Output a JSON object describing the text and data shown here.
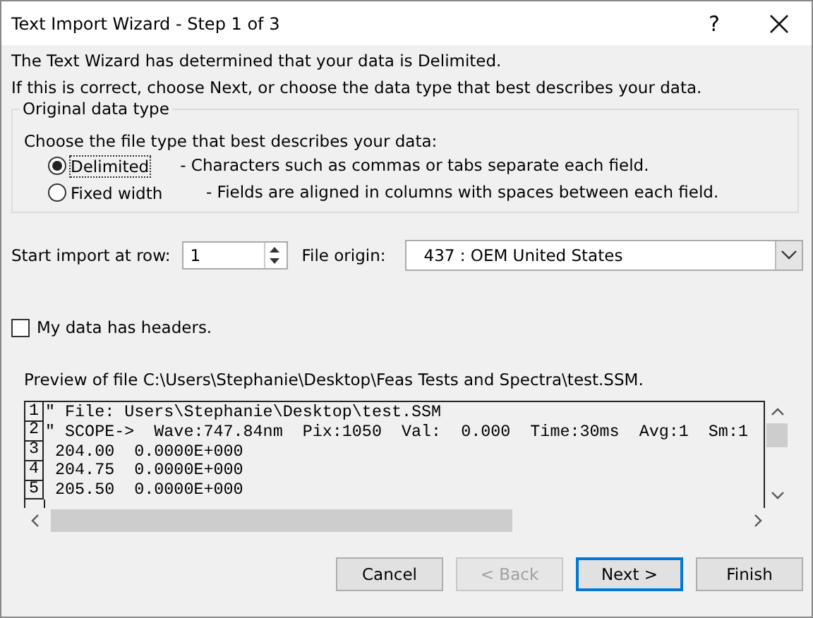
{
  "window": {
    "title": "Text Import Wizard - Step 1 of 3",
    "help": "?"
  },
  "intro": [
    "The Text Wizard has determined that your data is Delimited.",
    "If this is correct, choose Next, or choose the data type that best describes your data."
  ],
  "data_type": {
    "legend": "Original data type",
    "prompt": "Choose the file type that best describes your data:",
    "options": [
      {
        "label": "Delimited",
        "description": "- Characters such as commas or tabs separate each field.",
        "selected": true
      },
      {
        "label": "Fixed width",
        "description": "- Fields are aligned in columns with spaces between each field.",
        "selected": false
      }
    ]
  },
  "start_row": {
    "label": "Start import at row:",
    "value": "1"
  },
  "file_origin": {
    "label": "File origin:",
    "value": "437 : OEM United States"
  },
  "headers": {
    "label": "My data has headers.",
    "checked": false
  },
  "preview": {
    "caption": "Preview of file C:\\Users\\Stephanie\\Desktop\\Feas Tests and Spectra\\test.SSM.",
    "lines": [
      {
        "number": "1",
        "text": "\" File: Users\\Stephanie\\Desktop\\test.SSM"
      },
      {
        "number": "2",
        "text": "\" SCOPE->  Wave:747.84nm  Pix:1050  Val:  0.000  Time:30ms  Avg:1  Sm:1"
      },
      {
        "number": "3",
        "text": " 204.00  0.0000E+000"
      },
      {
        "number": "4",
        "text": " 204.75  0.0000E+000"
      },
      {
        "number": "5",
        "text": " 205.50  0.0000E+000"
      }
    ]
  },
  "buttons": [
    {
      "label": "Cancel",
      "disabled": false,
      "default": false
    },
    {
      "label": "< Back",
      "disabled": true,
      "default": false
    },
    {
      "label": "Next >",
      "disabled": false,
      "default": true
    },
    {
      "label": "Finish",
      "disabled": false,
      "default": false
    }
  ]
}
